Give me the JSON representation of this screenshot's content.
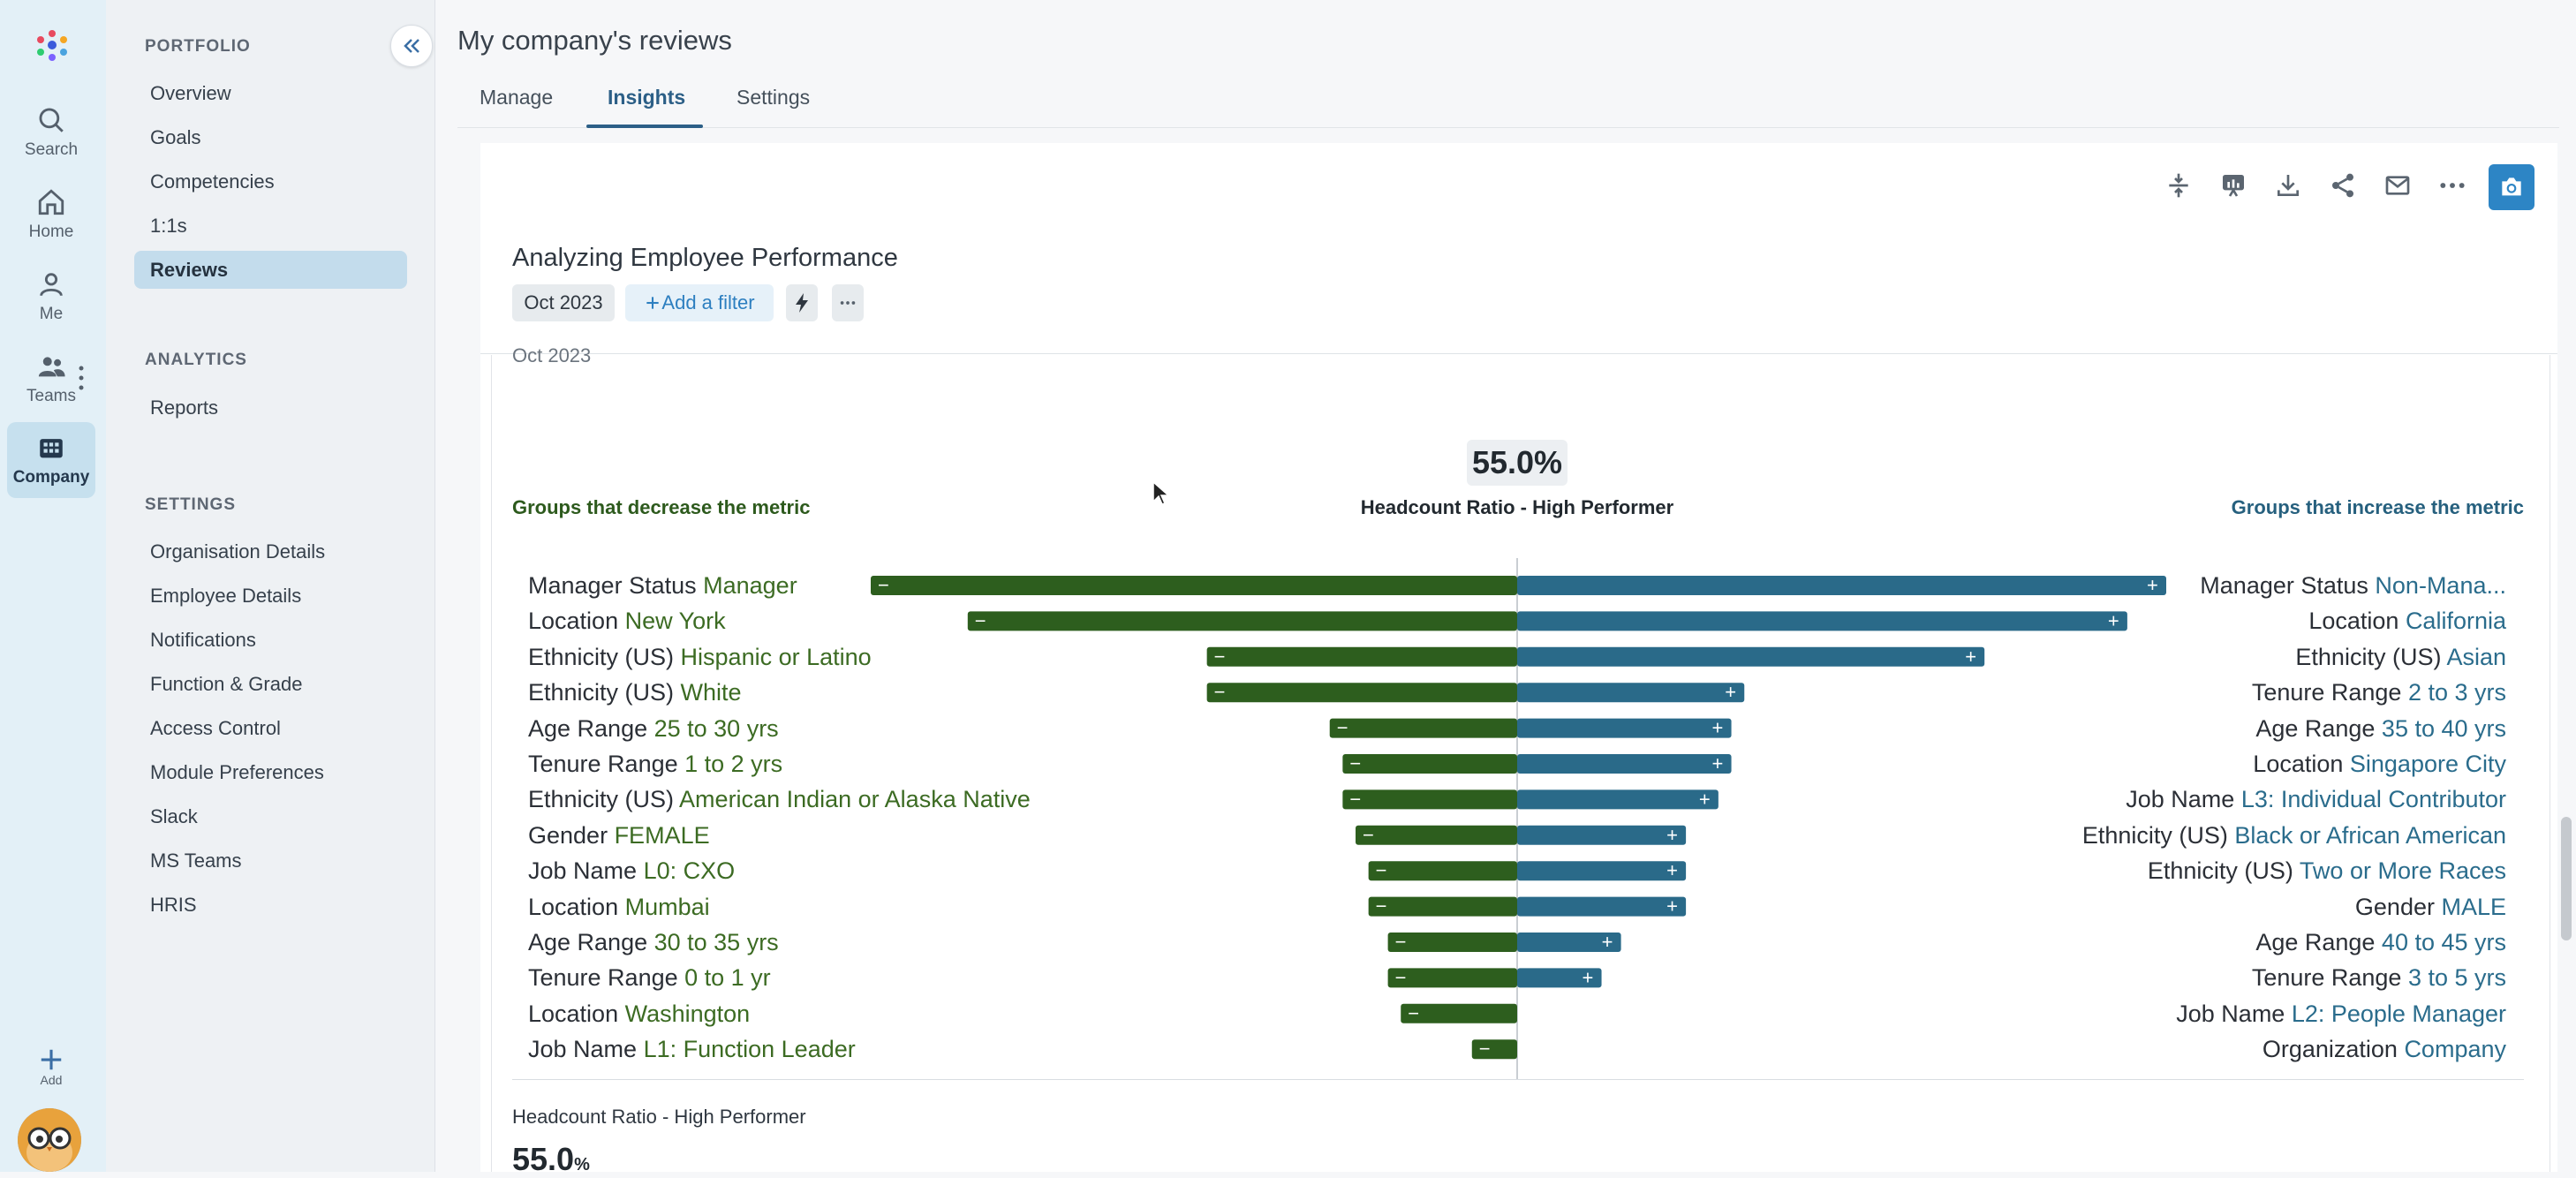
{
  "rail": {
    "items": [
      {
        "label": "Search",
        "icon": "search-icon"
      },
      {
        "label": "Home",
        "icon": "home-icon"
      },
      {
        "label": "Me",
        "icon": "person-icon"
      },
      {
        "label": "Teams",
        "icon": "people-icon"
      },
      {
        "label": "Company",
        "icon": "building-grid-icon",
        "active": true
      }
    ],
    "add_label": "Add"
  },
  "sidebar": {
    "portfolio_title": "PORTFOLIO",
    "portfolio": [
      "Overview",
      "Goals",
      "Competencies",
      "1:1s",
      "Reviews"
    ],
    "analytics_title": "ANALYTICS",
    "analytics": [
      "Reports"
    ],
    "settings_title": "SETTINGS",
    "settings": [
      "Organisation Details",
      "Employee Details",
      "Notifications",
      "Function & Grade",
      "Access Control",
      "Module Preferences",
      "Slack",
      "MS Teams",
      "HRIS"
    ]
  },
  "header": {
    "title": "My company's reviews",
    "tabs": [
      "Manage",
      "Insights",
      "Settings"
    ],
    "active_tab": "Insights"
  },
  "card": {
    "title": "Analyzing Employee Performance",
    "date_chip": "Oct 2023",
    "add_filter": "Add a filter",
    "date_caption": "Oct 2023"
  },
  "chart_data": {
    "type": "bar",
    "center_value": "55.0%",
    "metric": "Headcount Ratio - High Performer",
    "decrease_title": "Groups that decrease the metric",
    "increase_title": "Groups that increase the metric",
    "decrease": [
      {
        "group": "Manager Status",
        "value": "Manager",
        "magnitude": 1.0
      },
      {
        "group": "Location",
        "value": "New York",
        "magnitude": 0.85
      },
      {
        "group": "Ethnicity (US)",
        "value": "Hispanic or Latino",
        "magnitude": 0.48
      },
      {
        "group": "Ethnicity (US)",
        "value": "White",
        "magnitude": 0.48
      },
      {
        "group": "Age Range",
        "value": "25 to 30 yrs",
        "magnitude": 0.29
      },
      {
        "group": "Tenure Range",
        "value": "1 to 2 yrs",
        "magnitude": 0.27
      },
      {
        "group": "Ethnicity (US)",
        "value": "American Indian or Alaska Native",
        "magnitude": 0.27
      },
      {
        "group": "Gender",
        "value": "FEMALE",
        "magnitude": 0.25
      },
      {
        "group": "Job Name",
        "value": "L0: CXO",
        "magnitude": 0.23
      },
      {
        "group": "Location",
        "value": "Mumbai",
        "magnitude": 0.23
      },
      {
        "group": "Age Range",
        "value": "30 to 35 yrs",
        "magnitude": 0.2
      },
      {
        "group": "Tenure Range",
        "value": "0 to 1 yr",
        "magnitude": 0.2
      },
      {
        "group": "Location",
        "value": "Washington",
        "magnitude": 0.18
      },
      {
        "group": "Job Name",
        "value": "L1: Function Leader",
        "magnitude": 0.07
      }
    ],
    "increase": [
      {
        "group": "Manager Status",
        "value": "Non-Mana...",
        "magnitude": 1.0
      },
      {
        "group": "Location",
        "value": "California",
        "magnitude": 0.94
      },
      {
        "group": "Ethnicity (US)",
        "value": "Asian",
        "magnitude": 0.72
      },
      {
        "group": "Tenure Range",
        "value": "2 to 3 yrs",
        "magnitude": 0.35
      },
      {
        "group": "Age Range",
        "value": "35 to 40 yrs",
        "magnitude": 0.33
      },
      {
        "group": "Location",
        "value": "Singapore City",
        "magnitude": 0.33
      },
      {
        "group": "Job Name",
        "value": "L3: Individual Contributor",
        "magnitude": 0.31
      },
      {
        "group": "Ethnicity (US)",
        "value": "Black or African American",
        "magnitude": 0.26
      },
      {
        "group": "Ethnicity (US)",
        "value": "Two or More Races",
        "magnitude": 0.26
      },
      {
        "group": "Gender",
        "value": "MALE",
        "magnitude": 0.26
      },
      {
        "group": "Age Range",
        "value": "40 to 45 yrs",
        "magnitude": 0.16
      },
      {
        "group": "Tenure Range",
        "value": "3 to 5 yrs",
        "magnitude": 0.13
      },
      {
        "group": "Job Name",
        "value": "L2: People Manager",
        "magnitude": 0
      },
      {
        "group": "Organization",
        "value": "Company",
        "magnitude": 0
      }
    ],
    "colors": {
      "decrease": "#2d5e1e",
      "increase": "#2a6a89"
    }
  },
  "footer": {
    "metric": "Headcount Ratio - High Performer",
    "value": "55.0",
    "unit": "%"
  }
}
